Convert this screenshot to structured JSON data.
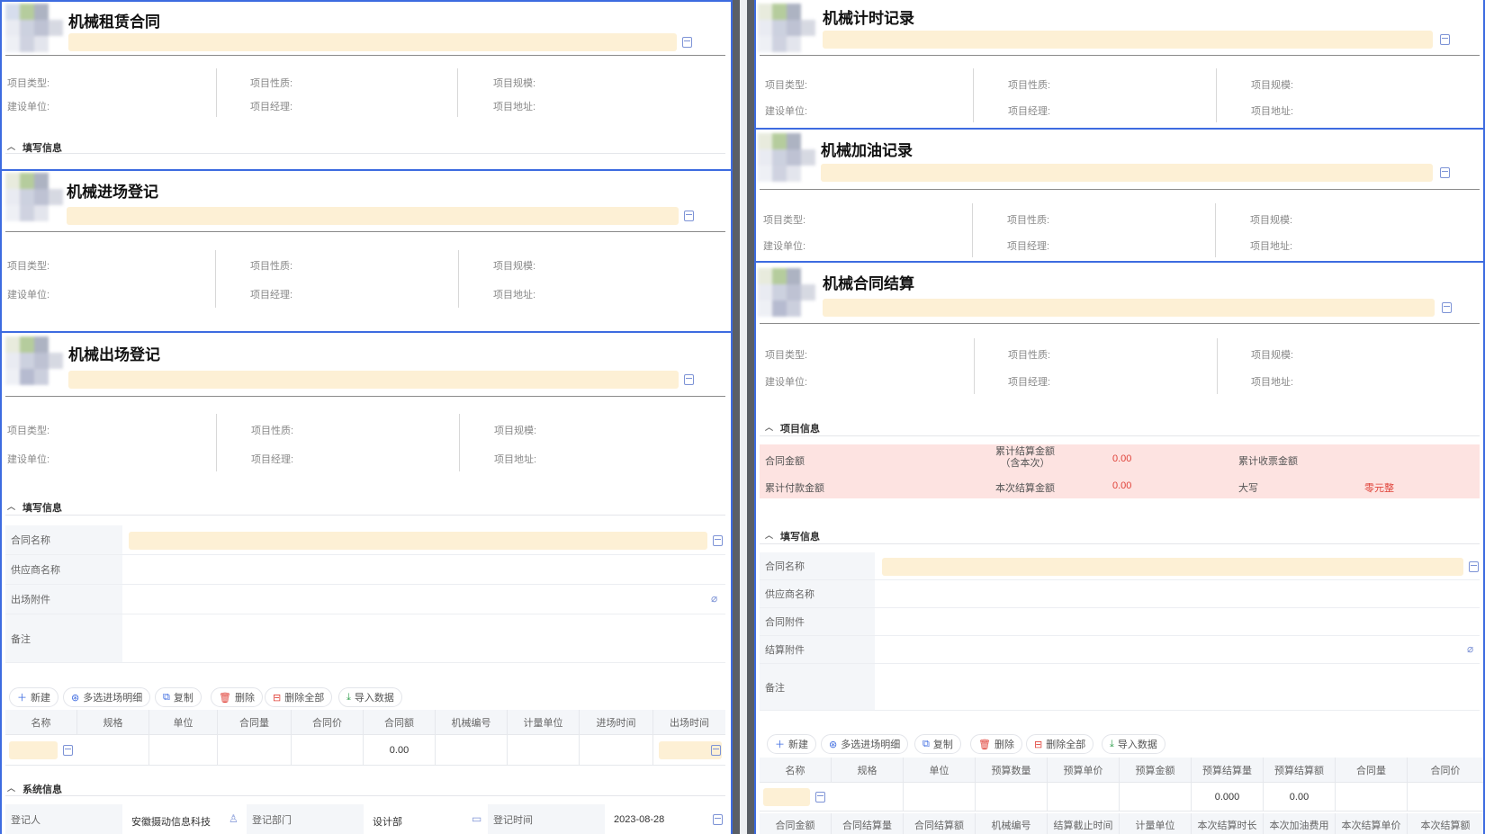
{
  "info_labels": {
    "type": "项目类型:",
    "nature": "项目性质:",
    "scale": "项目规模:",
    "builder": "建设单位:",
    "manager": "项目经理:",
    "address": "项目地址:"
  },
  "cards": {
    "rental": {
      "title": "机械租赁合同",
      "section": "填写信息"
    },
    "entry": {
      "title": "机械进场登记"
    },
    "exit": {
      "title": "机械出场登记"
    },
    "timing": {
      "title": "机械计时记录"
    },
    "refuel": {
      "title": "机械加油记录"
    },
    "settle": {
      "title": "机械合同结算"
    }
  },
  "exit_form": {
    "section": "填写信息",
    "contract_name": "合同名称",
    "supplier": "供应商名称",
    "attachment": "出场附件",
    "remark": "备注"
  },
  "toolbar": {
    "new": "新建",
    "multi": "多选进场明细",
    "copy": "复制",
    "delete": "删除",
    "delete_all": "删除全部",
    "import": "导入数据"
  },
  "exit_grid": {
    "columns": [
      "名称",
      "规格",
      "单位",
      "合同量",
      "合同价",
      "合同额",
      "机械编号",
      "计量单位",
      "进场时间",
      "出场时间"
    ],
    "row": {
      "amount": "0.00"
    }
  },
  "system": {
    "section": "系统信息",
    "registrar_label": "登记人",
    "registrar_value": "安徽摄动信息科技",
    "dept_label": "登记部门",
    "dept_value": "设计部",
    "time_label": "登记时间",
    "time_value": "2023-08-28"
  },
  "settle_info": {
    "section": "项目信息",
    "contract_amount": "合同金额",
    "cum_settle": "累计结算金额\n（含本次）",
    "cum_settle_value": "0.00",
    "cum_receipt": "累计收票金额",
    "cum_paid": "累计付款金额",
    "this_settle": "本次结算金额",
    "this_settle_value": "0.00",
    "capital": "大写",
    "capital_value": "零元整"
  },
  "settle_form": {
    "section": "填写信息",
    "contract_name": "合同名称",
    "supplier": "供应商名称",
    "contract_attach": "合同附件",
    "settle_attach": "结算附件",
    "remark": "备注"
  },
  "settle_grid": {
    "columns": [
      "名称",
      "规格",
      "单位",
      "预算数量",
      "预算单价",
      "预算金额",
      "预算结算量",
      "预算结算额",
      "合同量",
      "合同价"
    ],
    "row": {
      "budget_settle_qty": "0.000",
      "budget_settle_amt": "0.00"
    },
    "columns2": [
      "合同金额",
      "合同结算量",
      "合同结算额",
      "机械编号",
      "结算截止时间",
      "计量单位",
      "本次结算时长",
      "本次加油费用",
      "本次结算单价",
      "本次结算额"
    ]
  },
  "colors": {
    "accent": "#3d6be0",
    "field_yellow": "#fdf0d5",
    "pink": "#fde3e1",
    "red_text": "#e0433a"
  }
}
